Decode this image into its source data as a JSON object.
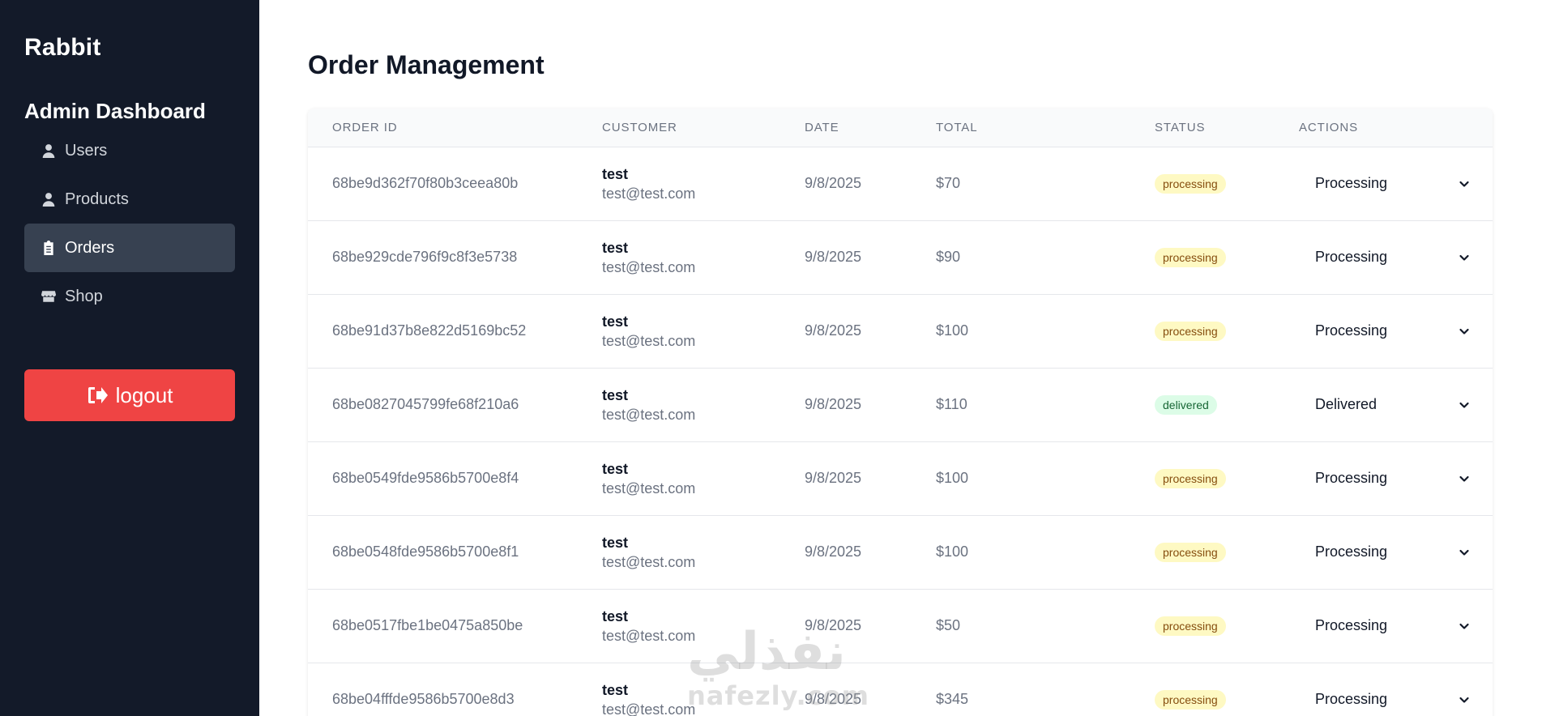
{
  "sidebar": {
    "brand": "Rabbit",
    "title": "Admin Dashboard",
    "items": [
      {
        "label": "Users",
        "icon": "user-icon",
        "active": false
      },
      {
        "label": "Products",
        "icon": "user-icon",
        "active": false
      },
      {
        "label": "Orders",
        "icon": "clipboard-icon",
        "active": true
      },
      {
        "label": "Shop",
        "icon": "store-icon",
        "active": false
      }
    ],
    "logout_label": "logout"
  },
  "main": {
    "title": "Order Management",
    "table": {
      "headers": [
        "ORDER ID",
        "CUSTOMER",
        "DATE",
        "TOTAL",
        "STATUS",
        "ACTIONS"
      ],
      "rows": [
        {
          "id": "68be9d362f70f80b3ceea80b",
          "name": "test",
          "email": "test@test.com",
          "date": "9/8/2025",
          "total": "$70",
          "status": "processing",
          "action": "Processing"
        },
        {
          "id": "68be929cde796f9c8f3e5738",
          "name": "test",
          "email": "test@test.com",
          "date": "9/8/2025",
          "total": "$90",
          "status": "processing",
          "action": "Processing"
        },
        {
          "id": "68be91d37b8e822d5169bc52",
          "name": "test",
          "email": "test@test.com",
          "date": "9/8/2025",
          "total": "$100",
          "status": "processing",
          "action": "Processing"
        },
        {
          "id": "68be0827045799fe68f210a6",
          "name": "test",
          "email": "test@test.com",
          "date": "9/8/2025",
          "total": "$110",
          "status": "delivered",
          "action": "Delivered"
        },
        {
          "id": "68be0549fde9586b5700e8f4",
          "name": "test",
          "email": "test@test.com",
          "date": "9/8/2025",
          "total": "$100",
          "status": "processing",
          "action": "Processing"
        },
        {
          "id": "68be0548fde9586b5700e8f1",
          "name": "test",
          "email": "test@test.com",
          "date": "9/8/2025",
          "total": "$100",
          "status": "processing",
          "action": "Processing"
        },
        {
          "id": "68be0517fbe1be0475a850be",
          "name": "test",
          "email": "test@test.com",
          "date": "9/8/2025",
          "total": "$50",
          "status": "processing",
          "action": "Processing"
        },
        {
          "id": "68be04fffde9586b5700e8d3",
          "name": "test",
          "email": "test@test.com",
          "date": "9/8/2025",
          "total": "$345",
          "status": "processing",
          "action": "Processing"
        }
      ]
    }
  },
  "watermark": {
    "arabic": "نفذلي",
    "latin": "nafezly.com"
  },
  "colors": {
    "sidebar_bg": "#131a29",
    "active_item_bg": "#374151",
    "logout_bg": "#ef4444",
    "processing_badge": "#fef9c3",
    "delivered_badge": "#dcfce7"
  }
}
